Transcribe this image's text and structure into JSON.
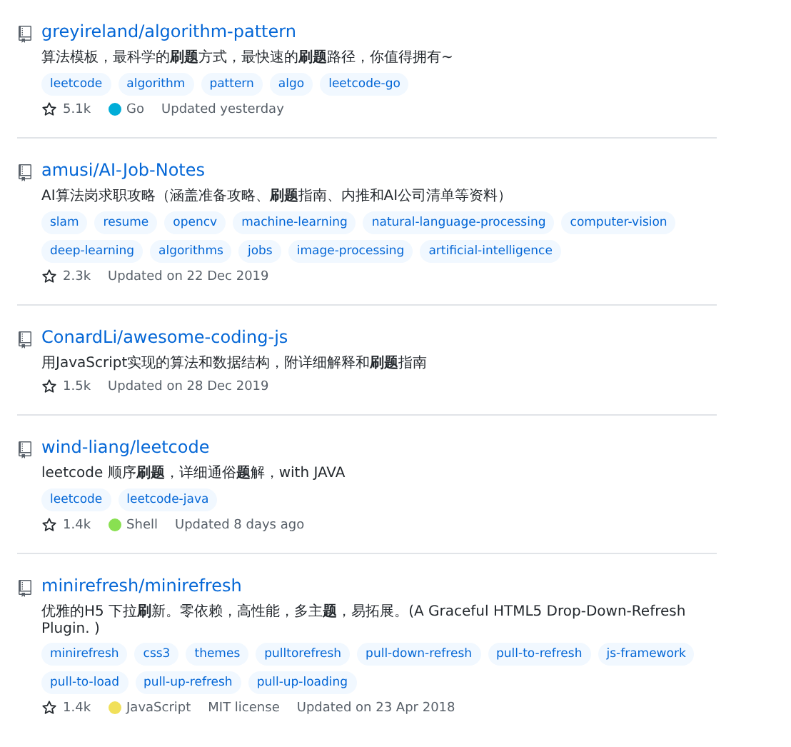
{
  "repos": [
    {
      "name": "greyireland/algorithm-pattern",
      "description": "算法模板，最科学的**刷题**方式，最快速的**刷题**路径，你值得拥有~",
      "topics": [
        "leetcode",
        "algorithm",
        "pattern",
        "algo",
        "leetcode-go"
      ],
      "stars": "5.1k",
      "language": {
        "name": "Go",
        "color": "#00add8"
      },
      "updated": "Updated yesterday"
    },
    {
      "name": "amusi/AI-Job-Notes",
      "description": "AI算法岗求职攻略（涵盖准备攻略、**刷题**指南、内推和AI公司清单等资料）",
      "topics": [
        "slam",
        "resume",
        "opencv",
        "machine-learning",
        "natural-language-processing",
        "computer-vision",
        "deep-learning",
        "algorithms",
        "jobs",
        "image-processing",
        "artificial-intelligence"
      ],
      "stars": "2.3k",
      "updated": "Updated on 22 Dec 2019"
    },
    {
      "name": "ConardLi/awesome-coding-js",
      "description": "用JavaScript实现的算法和数据结构，附详细解释和**刷题**指南",
      "stars": "1.5k",
      "updated": "Updated on 28 Dec 2019"
    },
    {
      "name": "wind-liang/leetcode",
      "description": "leetcode 顺序**刷题**，详细通俗**题**解，with JAVA",
      "topics": [
        "leetcode",
        "leetcode-java"
      ],
      "stars": "1.4k",
      "language": {
        "name": "Shell",
        "color": "#89e051"
      },
      "updated": "Updated 8 days ago"
    },
    {
      "name": "minirefresh/minirefresh",
      "description": "优雅的H5 下拉**刷**新。零依赖，高性能，多主**题**，易拓展。(A Graceful HTML5 Drop-Down-Refresh Plugin. )",
      "topics": [
        "minirefresh",
        "css3",
        "themes",
        "pulltorefresh",
        "pull-down-refresh",
        "pull-to-refresh",
        "js-framework",
        "pull-to-load",
        "pull-up-refresh",
        "pull-up-loading"
      ],
      "stars": "1.4k",
      "language": {
        "name": "JavaScript",
        "color": "#f1e05a"
      },
      "license": "MIT license",
      "updated": "Updated on 23 Apr 2018"
    }
  ]
}
